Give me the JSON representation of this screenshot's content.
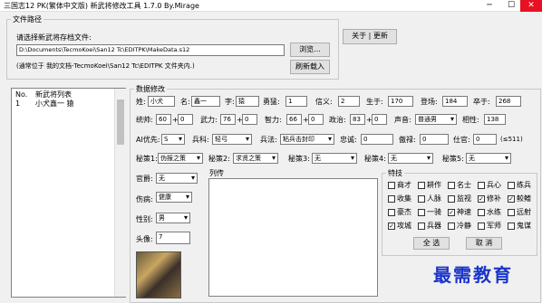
{
  "window": {
    "title": "三国志12 PK(繁体中文版)   新武将修改工具  1.7.0    By.Mirage",
    "minimize": "─",
    "maximize": "☐",
    "close": "✕"
  },
  "file": {
    "legend": "文件路径",
    "prompt": "请选择新武将存档文件:",
    "path": "D:\\Documents\\TecmoKoei\\San12 Tc\\EDITPK\\MakeData.s12",
    "browse": "浏览...",
    "hint": "(通常位于 我的文档-TecmoKoei\\San12 Tc\\EDITPK 文件夹内.)",
    "reload": "刷新载入"
  },
  "about": "关于 | 更新",
  "list": {
    "col_no": "No.",
    "col_name": "新武将列表",
    "rows": [
      {
        "no": "1",
        "name": "小犬鑫一 猿"
      }
    ]
  },
  "stats": {
    "legend": "数据修改",
    "surname_label": "姓:",
    "surname": "小犬",
    "name_label": "名:",
    "name": "鑫一",
    "style_label": "字:",
    "style": "猿",
    "valor_label": "勇猛:",
    "valor": "1",
    "duty_label": "信义:",
    "duty": "2",
    "born_label": "生于:",
    "born": "170",
    "appear_label": "登场:",
    "appear": "184",
    "death_label": "卒于:",
    "death": "268",
    "lead_label": "统帅:",
    "lead": "60",
    "lead_bonus": "0",
    "war_label": "武力:",
    "war": "76",
    "war_bonus": "0",
    "int_label": "智力:",
    "int": "66",
    "int_bonus": "0",
    "pol_label": "政治:",
    "pol": "83",
    "pol_bonus": "0",
    "voice_label": "声音:",
    "voice": "普通男",
    "compat_label": "相性:",
    "compat": "138",
    "ai_label": "AI优先:",
    "ai": "S",
    "unit_label": "兵科:",
    "unit": "轻弓",
    "tactic_label": "兵法:",
    "tactic": "粘兵击封印",
    "loyal_label": "忠诚:",
    "loyal": "0",
    "haughty_label": "傲禄:",
    "haughty": "0",
    "rank_label": "仕官:",
    "rank": "0",
    "rank_max": "(≤511)",
    "secret1_label": "秘策1:",
    "secret1": "伪报之策",
    "secret2_label": "秘策2:",
    "secret2": "求贤之策",
    "secret3_label": "秘策3:",
    "secret3": "无",
    "secret4_label": "秘策4:",
    "secret4": "无",
    "secret5_label": "秘策5:",
    "secret5": "无",
    "office_label": "官爵:",
    "office": "无",
    "injury_label": "伤病:",
    "injury": "健康",
    "gender_label": "性别:",
    "gender": "男",
    "portrait_label": "头像:",
    "portrait": "7",
    "bio_label": "列传"
  },
  "traits": {
    "legend": "特技",
    "items": [
      {
        "label": "商才",
        "checked": false
      },
      {
        "label": "耕作",
        "checked": false
      },
      {
        "label": "名士",
        "checked": false
      },
      {
        "label": "兵心",
        "checked": false
      },
      {
        "label": "练兵",
        "checked": false
      },
      {
        "label": "收集",
        "checked": false
      },
      {
        "label": "人脉",
        "checked": false
      },
      {
        "label": "监视",
        "checked": false
      },
      {
        "label": "修补",
        "checked": true
      },
      {
        "label": "鲛鳍",
        "checked": true
      },
      {
        "label": "豪杰",
        "checked": false
      },
      {
        "label": "一骑",
        "checked": false
      },
      {
        "label": "神速",
        "checked": true
      },
      {
        "label": "水练",
        "checked": false
      },
      {
        "label": "远射",
        "checked": false
      },
      {
        "label": "攻城",
        "checked": true
      },
      {
        "label": "兵器",
        "checked": false
      },
      {
        "label": "冷静",
        "checked": false
      },
      {
        "label": "军师",
        "checked": false
      },
      {
        "label": "鬼谋",
        "checked": false
      }
    ],
    "check_mark": "✓",
    "select_all": "全 选",
    "cancel": "取 消"
  },
  "watermark": "最需教育"
}
